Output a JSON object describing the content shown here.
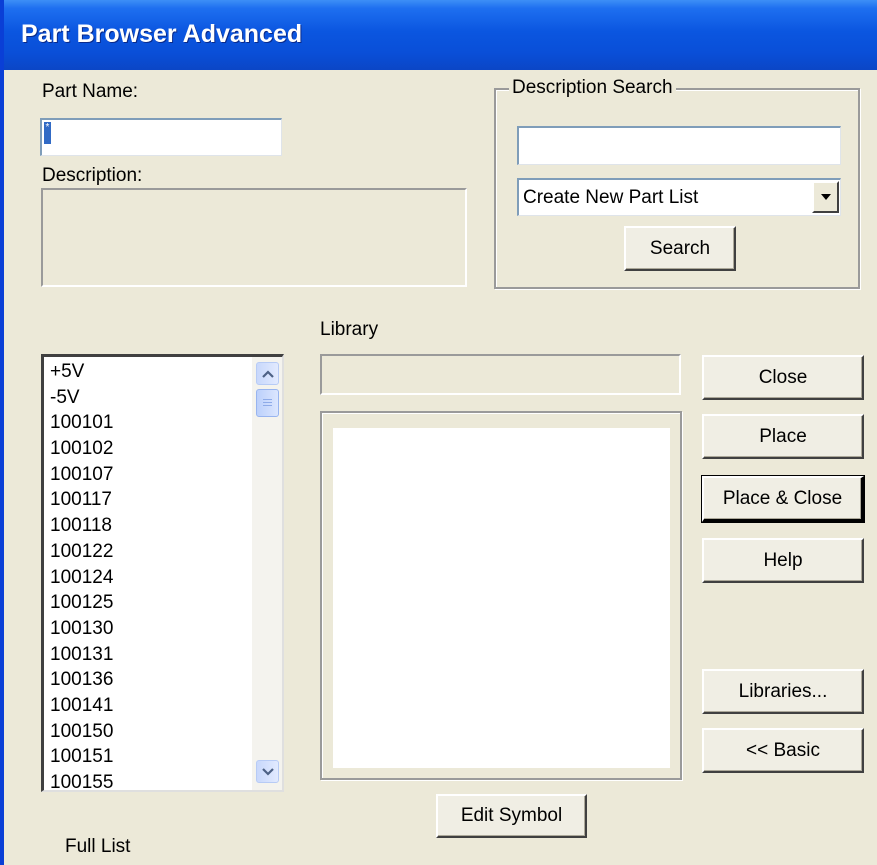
{
  "window": {
    "title": "Part Browser Advanced"
  },
  "part_name": {
    "label": "Part Name:",
    "value": "*"
  },
  "description": {
    "label": "Description:",
    "value": ""
  },
  "description_search": {
    "legend": "Description Search",
    "query": "",
    "mode_selected": "Create New Part List",
    "search_label": "Search"
  },
  "library": {
    "label": "Library",
    "value": ""
  },
  "parts_list": {
    "items": [
      "+5V",
      "-5V",
      "100101",
      "100102",
      "100107",
      "100117",
      "100118",
      "100122",
      "100124",
      "100125",
      "100130",
      "100131",
      "100136",
      "100141",
      "100150",
      "100151",
      "100155"
    ],
    "caption": "Full List"
  },
  "buttons": {
    "close": "Close",
    "place": "Place",
    "place_close": "Place & Close",
    "help": "Help",
    "libraries": "Libraries...",
    "basic": "<< Basic",
    "edit_symbol": "Edit Symbol"
  },
  "icons": {
    "scroll_up": "chevron-up-icon",
    "scroll_down": "chevron-down-icon",
    "dropdown": "triangle-down-icon"
  }
}
